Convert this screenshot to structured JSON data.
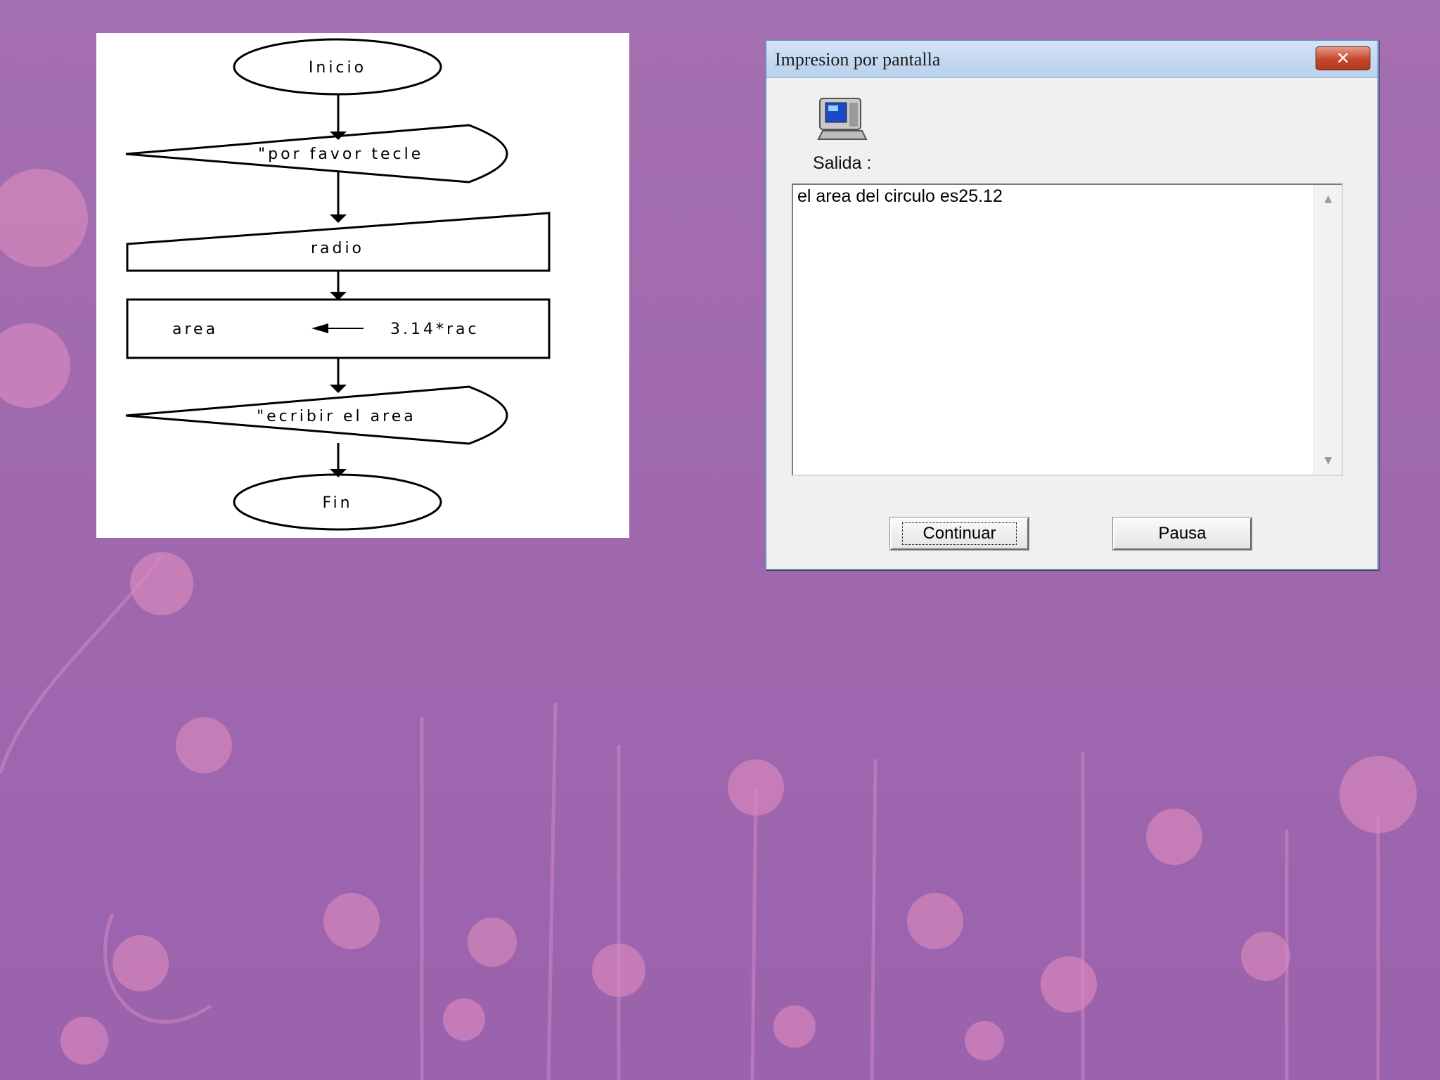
{
  "flowchart": {
    "start_label": "Inicio",
    "input_prompt_label": "\"por  favor tecle",
    "input_label": "radio",
    "process_target": "area",
    "process_expression": "3.14*rac",
    "output_label": "\"ecribir  el area",
    "end_label": "Fin"
  },
  "dialog": {
    "title": "Impresion por pantalla",
    "close_label": "✕",
    "output_label": "Salida :",
    "output_text": "el area del circulo es25.12",
    "buttons": {
      "continue_label": "Continuar",
      "pause_label": "Pausa"
    },
    "icon": "computer-icon"
  },
  "colors": {
    "background": "#a46fb0",
    "flower_pink": "#e58fbf",
    "titlebar": "#c6dbf2",
    "close_button": "#c5472c"
  }
}
